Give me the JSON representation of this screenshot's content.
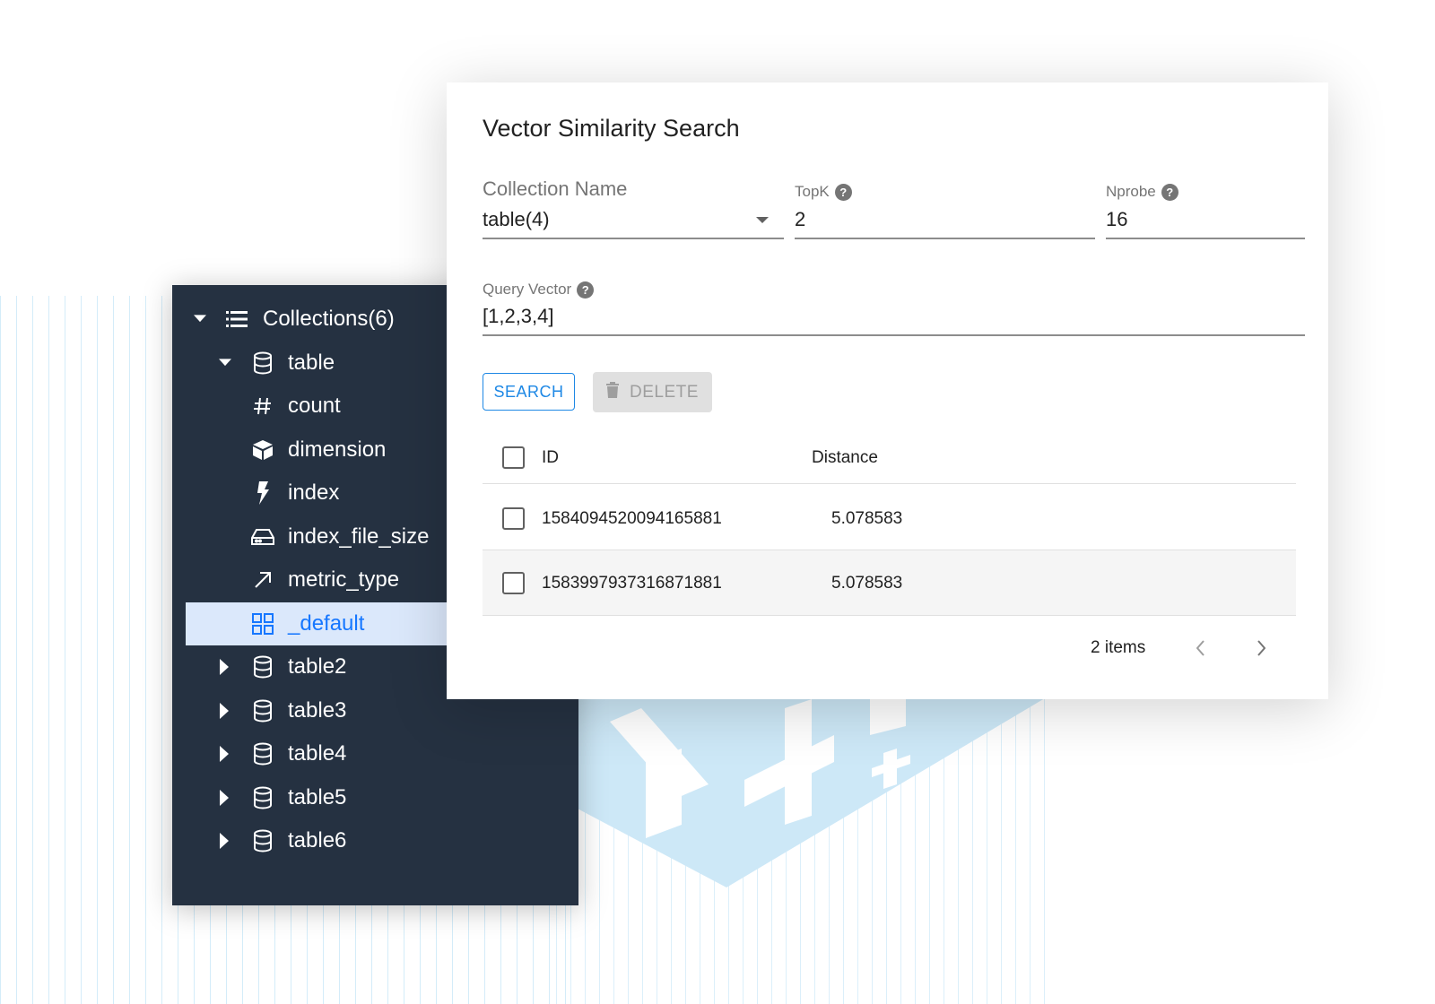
{
  "tree": {
    "root": {
      "label": "Collections(6)",
      "expanded": true,
      "icon": "list-icon"
    },
    "collections": [
      {
        "label": "table",
        "expanded": true,
        "icon": "database-icon",
        "children": [
          {
            "label": "count",
            "icon": "hash-icon"
          },
          {
            "label": "dimension",
            "icon": "cube-icon"
          },
          {
            "label": "index",
            "icon": "lightning-icon"
          },
          {
            "label": "index_file_size",
            "icon": "hard-drive-icon"
          },
          {
            "label": "metric_type",
            "icon": "arrow-up-right-icon"
          },
          {
            "label": "_default",
            "icon": "grid-icon",
            "selected": true
          }
        ]
      },
      {
        "label": "table2",
        "expanded": false,
        "icon": "database-icon"
      },
      {
        "label": "table3",
        "expanded": false,
        "icon": "database-icon"
      },
      {
        "label": "table4",
        "expanded": false,
        "icon": "database-icon"
      },
      {
        "label": "table5",
        "expanded": false,
        "icon": "database-icon"
      },
      {
        "label": "table6",
        "expanded": false,
        "icon": "database-icon"
      }
    ]
  },
  "dialog": {
    "title": "Vector Similarity Search",
    "collection_name": {
      "label": "Collection Name",
      "value": "table(4)"
    },
    "topk": {
      "label": "TopK",
      "value": "2",
      "help_icon": "question-circle-icon"
    },
    "nprobe": {
      "label": "Nprobe",
      "value": "16",
      "help_icon": "question-circle-icon"
    },
    "query_vector": {
      "label": "Query Vector",
      "value": "[1,2,3,4]",
      "help_icon": "question-circle-icon"
    },
    "search_label": "SEARCH",
    "delete_label": "DELETE",
    "table": {
      "columns": [
        "ID",
        "Distance"
      ],
      "rows": [
        {
          "id": "1584094520094165881",
          "distance": "5.078583"
        },
        {
          "id": "1583997937316871881",
          "distance": "5.078583"
        }
      ]
    },
    "pagination": {
      "count_text": "2 items"
    }
  },
  "colors": {
    "panel_bg": "#253141",
    "selected_bg": "#dbe8fb",
    "selected_text": "#1677ff",
    "accent": "#1e88e5",
    "decor_blue": "#cde8f7"
  }
}
